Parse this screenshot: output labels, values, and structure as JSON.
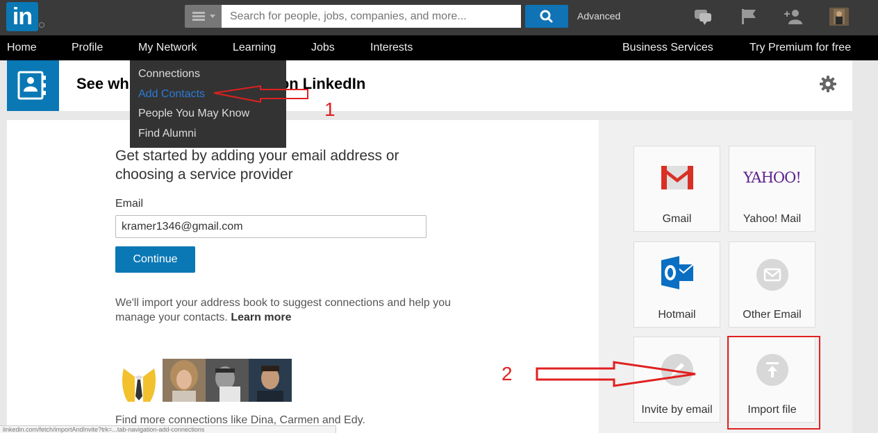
{
  "topbar": {
    "logo_text": "in",
    "search_placeholder": "Search for people, jobs, companies, and more...",
    "advanced_label": "Advanced"
  },
  "nav": {
    "home": "Home",
    "profile": "Profile",
    "my_network": "My Network",
    "learning": "Learning",
    "jobs": "Jobs",
    "interests": "Interests",
    "business_services": "Business Services",
    "try_premium": "Try Premium for free"
  },
  "dropdown": {
    "connections": "Connections",
    "add_contacts": "Add Contacts",
    "people_you_may_know": "People You May Know",
    "find_alumni": "Find Alumni"
  },
  "header": {
    "title_left": "See wh",
    "title_right": "on LinkedIn"
  },
  "main": {
    "headline": "Get started by adding your email address or choosing a service provider",
    "email_label": "Email",
    "email_value": "kramer1346@gmail.com",
    "continue_label": "Continue",
    "info_text": "We'll import your address book to suggest connections and help you manage your contacts.",
    "learn_more": "Learn more",
    "find_more": "Find more connections like Dina, Carmen and Edy."
  },
  "providers": {
    "gmail": "Gmail",
    "yahoo_logo": "YAHOO!",
    "yahoo": "Yahoo! Mail",
    "hotmail": "Hotmail",
    "other_email": "Other Email",
    "invite_by_email": "Invite by email",
    "import_file": "Import file"
  },
  "annotations": {
    "one": "1",
    "two": "2"
  },
  "statusbar": {
    "text": "linkedin.com/fetch/importAndInvite?trk=...tab-navigation-add-connections"
  },
  "colors": {
    "brand_blue": "#0a78b5",
    "annotation_red": "#e02020"
  }
}
